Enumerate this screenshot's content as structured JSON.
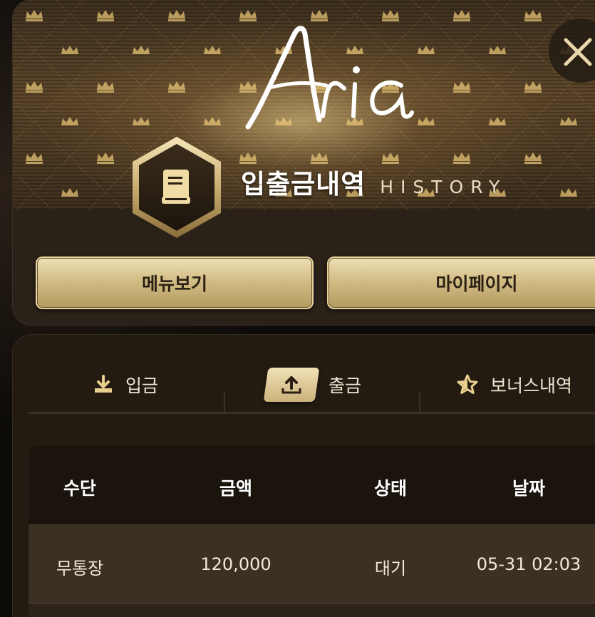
{
  "header": {
    "logo_text": "Aria",
    "title_ko": "입출금내역",
    "title_en": "HISTORY",
    "close_label": "×"
  },
  "nav": {
    "menu_label": "메뉴보기",
    "mypage_label": "마이페이지"
  },
  "tabs": [
    {
      "label": "입금",
      "icon": "download-icon",
      "active": false
    },
    {
      "label": "출금",
      "icon": "upload-icon",
      "active": true
    },
    {
      "label": "보너스내역",
      "icon": "star-icon",
      "active": false
    }
  ],
  "table": {
    "columns": [
      "수단",
      "금액",
      "상태",
      "날짜"
    ],
    "rows": [
      {
        "method": "무통장",
        "amount": "120,000",
        "status": "대기",
        "date": "05-31 02:03"
      }
    ]
  },
  "colors": {
    "gold": "#d2bd86",
    "background": "#0d0b08",
    "card": "#231b12"
  }
}
